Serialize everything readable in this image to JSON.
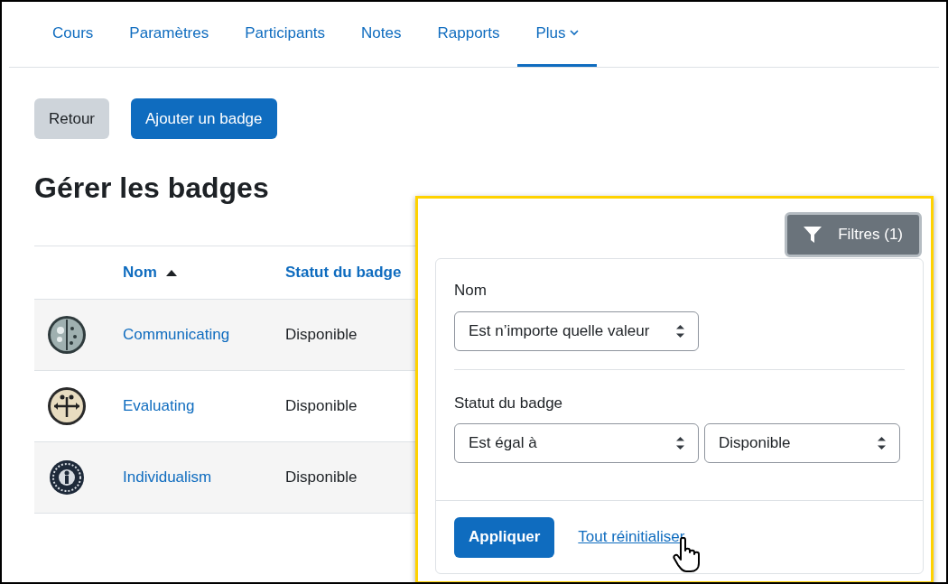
{
  "nav": {
    "tabs": [
      {
        "label": "Cours",
        "selected": false,
        "dropdown": false
      },
      {
        "label": "Paramètres",
        "selected": false,
        "dropdown": false
      },
      {
        "label": "Participants",
        "selected": false,
        "dropdown": false
      },
      {
        "label": "Notes",
        "selected": false,
        "dropdown": false
      },
      {
        "label": "Rapports",
        "selected": false,
        "dropdown": false
      },
      {
        "label": "Plus",
        "selected": true,
        "dropdown": true
      }
    ]
  },
  "actions": [
    {
      "label": "Retour",
      "kind": "secondary"
    },
    {
      "label": "Ajouter un badge",
      "kind": "primary"
    }
  ],
  "heading": "Gérer les badges",
  "table": {
    "columns": [
      {
        "label": "Nom",
        "sorted_ascending": true
      },
      {
        "label": "Statut du badge",
        "sorted_ascending": false
      }
    ],
    "rows": [
      {
        "name": "Communicating",
        "status": "Disponible",
        "kind": "brain"
      },
      {
        "name": "Evaluating",
        "status": "Disponible",
        "kind": "scale"
      },
      {
        "name": "Individualism",
        "status": "Disponible",
        "kind": "person"
      }
    ]
  },
  "filter": {
    "button": "Filtres (1)",
    "groups": [
      {
        "label": "Nom",
        "selects": [
          "Est n’importe quelle valeur"
        ]
      },
      {
        "label": "Statut du badge",
        "selects": [
          "Est égal à",
          "Disponible"
        ]
      }
    ],
    "apply": "Appliquer",
    "reset": "Tout réinitialiser"
  }
}
